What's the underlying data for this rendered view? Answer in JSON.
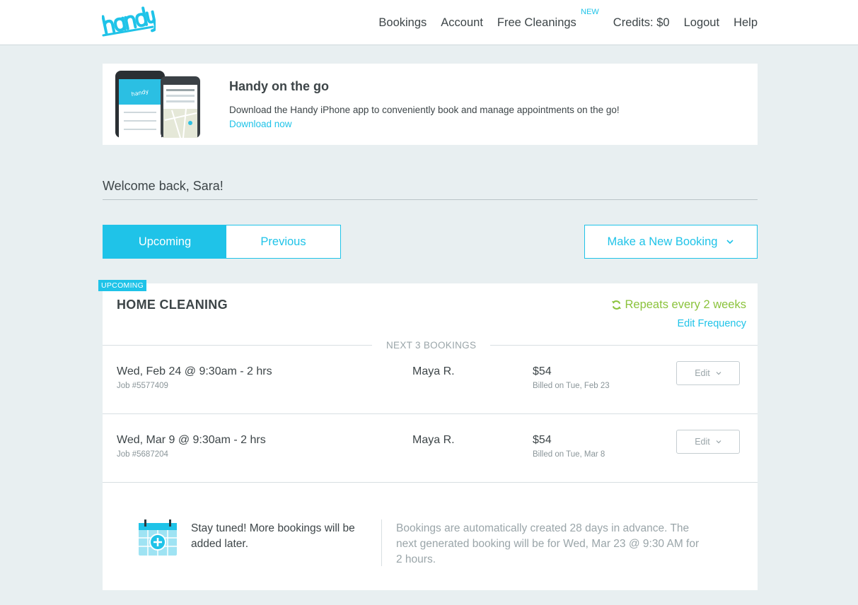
{
  "header": {
    "logo_text": "handy",
    "nav": [
      {
        "label": "Bookings"
      },
      {
        "label": "Account"
      },
      {
        "label": "Free Cleanings",
        "badge": "NEW"
      },
      {
        "label": "Credits: $0"
      },
      {
        "label": "Logout"
      },
      {
        "label": "Help"
      }
    ]
  },
  "promo": {
    "title": "Handy on the go",
    "description": "Download the Handy iPhone app to conveniently book and manage appointments on the go!",
    "link": "Download now"
  },
  "welcome": "Welcome back, Sara!",
  "tabs": [
    {
      "label": "Upcoming",
      "active": true
    },
    {
      "label": "Previous",
      "active": false
    }
  ],
  "new_booking_label": "Make a New Booking",
  "card": {
    "tag": "UPCOMING",
    "title": "HOME CLEANING",
    "repeats": "Repeats every 2 weeks",
    "edit_frequency": "Edit Frequency",
    "next_label": "NEXT 3 BOOKINGS",
    "bookings": [
      {
        "when": "Wed, Feb 24 @ 9:30am - 2 hrs",
        "job": "Job #5577409",
        "pro": "Maya R.",
        "price": "$54",
        "billed": "Billed on Tue, Feb 23",
        "edit": "Edit"
      },
      {
        "when": "Wed, Mar 9 @ 9:30am - 2 hrs",
        "job": "Job #5687204",
        "pro": "Maya R.",
        "price": "$54",
        "billed": "Billed on Tue, Mar 8",
        "edit": "Edit"
      }
    ],
    "stay_tuned": "Stay tuned! More bookings will be added later.",
    "auto_info": "Bookings are automatically created 28 days in advance. The next generated booking will be for Wed, Mar 23 @ 9:30 AM for 2 hours."
  },
  "colors": {
    "accent": "#1fc3e8",
    "green": "#8bc33c",
    "background": "#e8eff1"
  },
  "icons": [
    "handy-logo",
    "phones-image",
    "chevron-down-icon",
    "refresh-icon",
    "calendar-plus-icon"
  ]
}
